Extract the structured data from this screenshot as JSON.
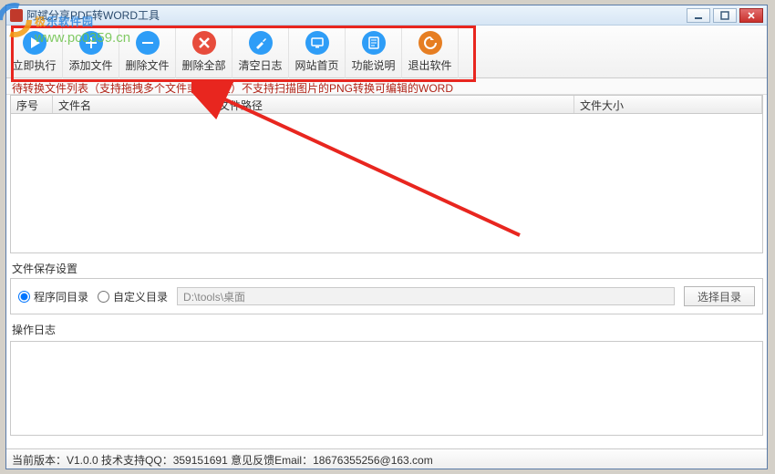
{
  "window": {
    "title": "阿斌分享PDF转WORD工具"
  },
  "toolbar": {
    "run": "立即执行",
    "add": "添加文件",
    "remove": "删除文件",
    "removeAll": "删除全部",
    "clearLog": "清空日志",
    "website": "网站首页",
    "help": "功能说明",
    "exit": "退出软件"
  },
  "listHint": "待转换文件列表（支持拖拽多个文件或文件夹）不支持扫描图片的PNG转换可编辑的WORD",
  "columns": {
    "idx": "序号",
    "name": "文件名",
    "path": "文件路径",
    "size": "文件大小"
  },
  "saveGroup": {
    "title": "文件保存设置",
    "optSame": "程序同目录",
    "optCustom": "自定义目录",
    "path": "D:\\tools\\桌面",
    "browse": "选择目录"
  },
  "logGroup": {
    "title": "操作日志"
  },
  "status": {
    "text": "当前版本：V1.0.0   技术支持QQ：359151691   意见反馈Email：18676355256@163.com"
  },
  "watermark": {
    "line1a": "极",
    "line1b": "乐软件园",
    "url": "www.pc0359.cn"
  }
}
